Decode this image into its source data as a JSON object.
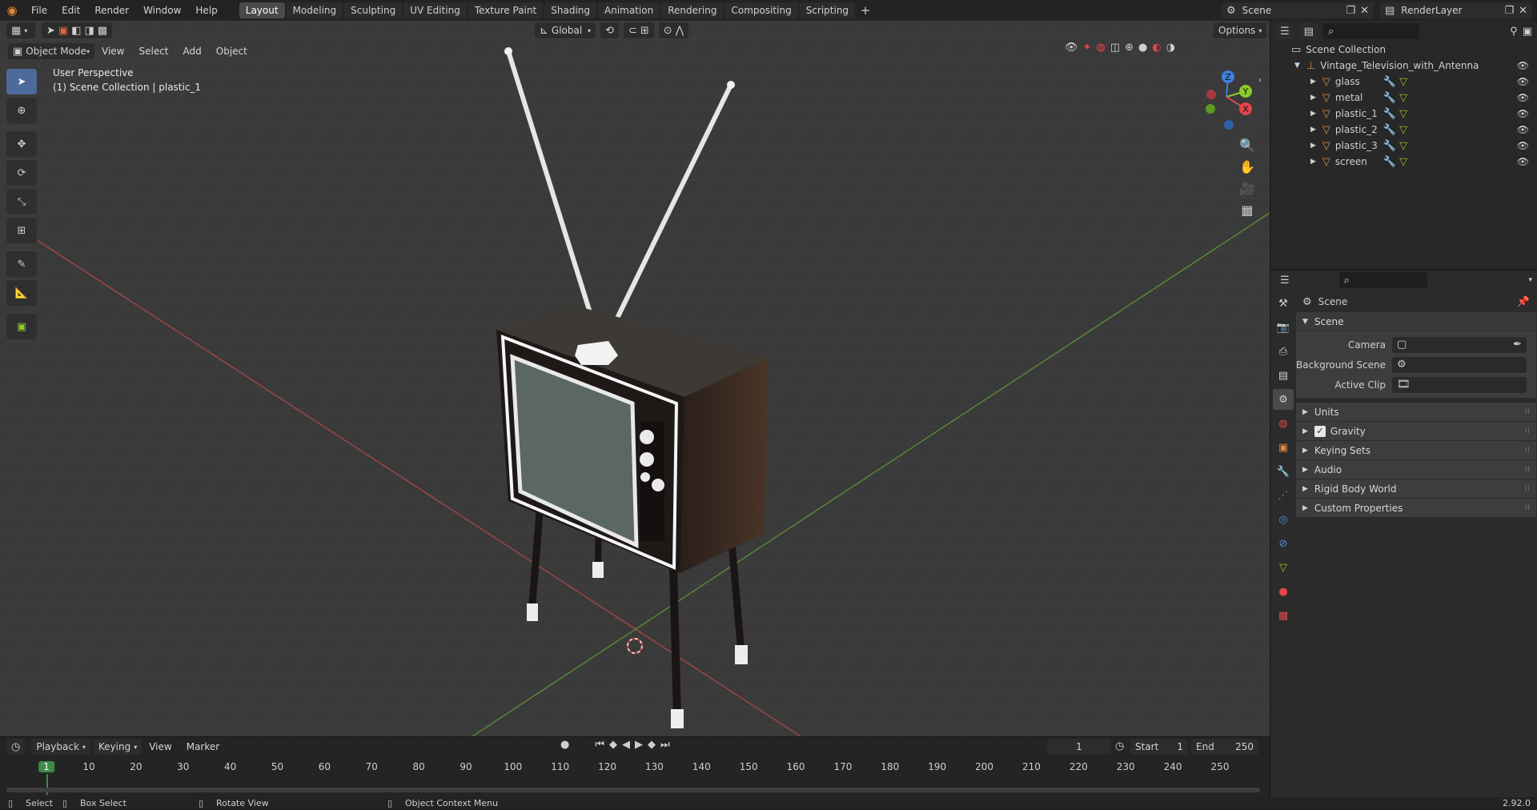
{
  "menu": {
    "file": "File",
    "edit": "Edit",
    "render": "Render",
    "window": "Window",
    "help": "Help"
  },
  "workspaces": [
    "Layout",
    "Modeling",
    "Sculpting",
    "UV Editing",
    "Texture Paint",
    "Shading",
    "Animation",
    "Rendering",
    "Compositing",
    "Scripting"
  ],
  "active_workspace": "Layout",
  "scene_selector": "Scene",
  "view_layer_selector": "RenderLayer",
  "viewport": {
    "mode": "Object Mode",
    "menus": [
      "View",
      "Select",
      "Add",
      "Object"
    ],
    "transform_orientation": "Global",
    "options_label": "Options",
    "overlay_title": "User Perspective",
    "overlay_subtitle": "(1) Scene Collection | plastic_1",
    "gizmo": {
      "x": "X",
      "y": "Y",
      "z": "Z"
    }
  },
  "outliner": {
    "root": "Scene Collection",
    "collection": "Vintage_Television_with_Antenna",
    "objects": [
      "glass",
      "metal",
      "plastic_1",
      "plastic_2",
      "plastic_3",
      "screen"
    ]
  },
  "properties": {
    "breadcrumb": "Scene",
    "panel_title": "Scene",
    "fields": {
      "camera": "Camera",
      "background_scene": "Background Scene",
      "active_clip": "Active Clip"
    },
    "subpanels": [
      "Units",
      "Gravity",
      "Keying Sets",
      "Audio",
      "Rigid Body World",
      "Custom Properties"
    ],
    "gravity_checked": true
  },
  "timeline": {
    "menus": [
      "Playback",
      "Keying",
      "View",
      "Marker"
    ],
    "current_frame": "1",
    "start_label": "Start",
    "start_value": "1",
    "end_label": "End",
    "end_value": "250",
    "ticks": [
      "1",
      "10",
      "20",
      "30",
      "40",
      "50",
      "60",
      "70",
      "80",
      "90",
      "100",
      "110",
      "120",
      "130",
      "140",
      "150",
      "160",
      "170",
      "180",
      "190",
      "200",
      "210",
      "220",
      "230",
      "240",
      "250"
    ]
  },
  "statusbar": {
    "select": "Select",
    "box_select": "Box Select",
    "rotate_view": "Rotate View",
    "context_menu": "Object Context Menu",
    "version": "2.92.0"
  },
  "colors": {
    "accent_active": "#4d6a9a",
    "x_axis": "#e2464c",
    "y_axis": "#8ccb2a",
    "z_axis": "#3f7fe0",
    "object_orange": "#e0873a",
    "selected_text": "#ffffff"
  }
}
